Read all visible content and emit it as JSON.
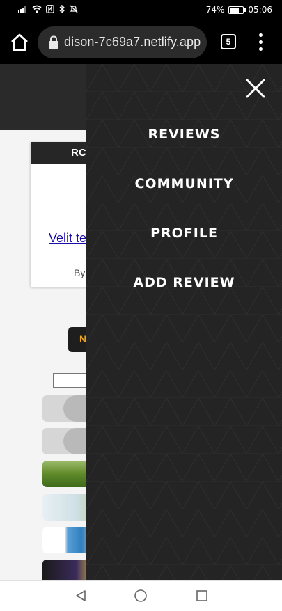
{
  "status_bar": {
    "battery_percent": "74%",
    "battery_level": 0.74,
    "time": "05:06"
  },
  "browser": {
    "url": "dison-7c69a7.netlify.app",
    "tab_count": "5"
  },
  "page": {
    "card_title": "RC",
    "card_link": "Velit te",
    "card_byline": "By",
    "button_label": "N"
  },
  "side_nav": {
    "items": [
      "REVIEWS",
      "COMMUNITY",
      "PROFILE",
      "ADD REVIEW"
    ]
  },
  "colors": {
    "nav_bg": "#242424",
    "accent": "#f0a520",
    "link": "#1a0dab"
  },
  "icons": [
    "signal-icon",
    "wifi-icon",
    "nfc-icon",
    "bluetooth-icon",
    "mute-icon",
    "battery-icon",
    "home-icon",
    "lock-icon",
    "tabs-icon",
    "overflow-menu-icon",
    "close-icon",
    "back-icon",
    "home-circle-icon",
    "recent-apps-icon"
  ]
}
